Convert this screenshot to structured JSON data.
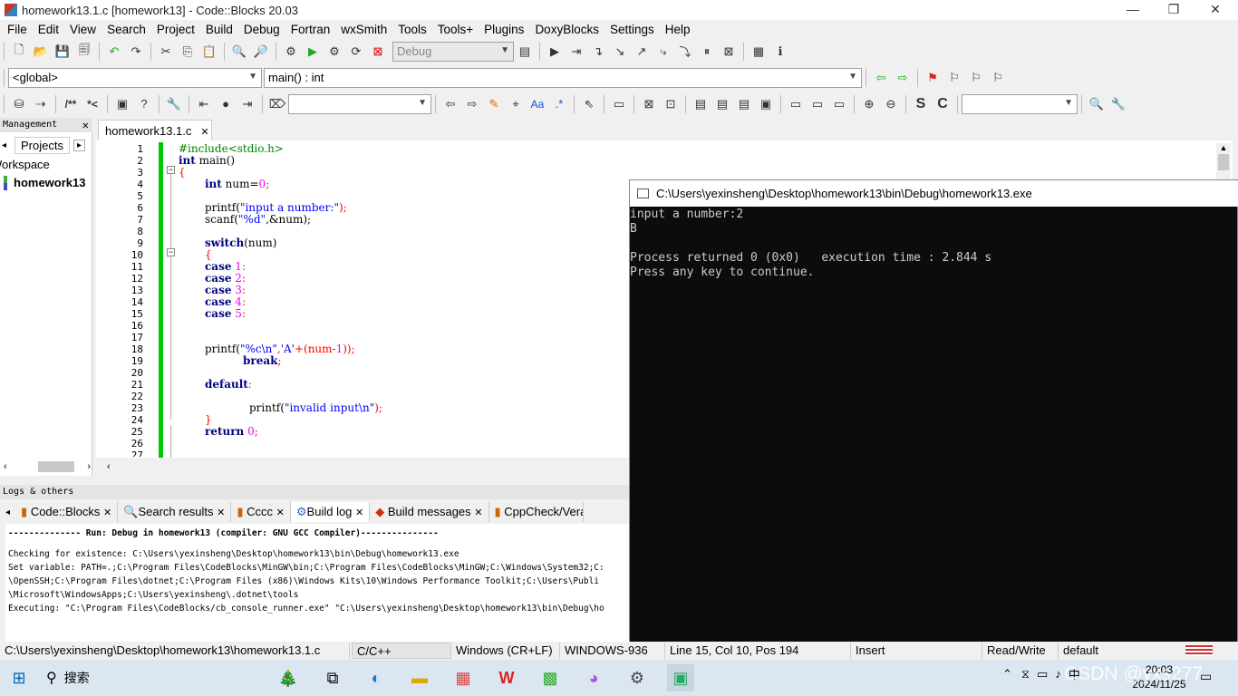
{
  "window": {
    "title": "homework13.1.c [homework13] - Code::Blocks 20.03",
    "min": "—",
    "max": "❐",
    "close": "✕"
  },
  "menu": [
    "File",
    "Edit",
    "View",
    "Search",
    "Project",
    "Build",
    "Debug",
    "Fortran",
    "wxSmith",
    "Tools",
    "Tools+",
    "Plugins",
    "DoxyBlocks",
    "Settings",
    "Help"
  ],
  "toolbar": {
    "build_target": "Debug",
    "scope": "<global>",
    "function": "main() : int"
  },
  "management": {
    "header": "Management",
    "tab": "Projects",
    "workspace": "Workspace",
    "project": "homework13"
  },
  "editor": {
    "tab": "homework13.1.c",
    "lines": [
      "1",
      "2",
      "3",
      "4",
      "5",
      "6",
      "7",
      "8",
      "9",
      "10",
      "11",
      "12",
      "13",
      "14",
      "15",
      "16",
      "17",
      "18",
      "19",
      "20",
      "21",
      "22",
      "23",
      "24",
      "25",
      "26",
      "27"
    ],
    "code": {
      "l1": "#include<stdio.h>",
      "l2_kw": "int",
      "l2_rest": " main()",
      "l3": "{",
      "l4_kw": "int",
      "l4_rest": " num=",
      "l4_num": "0",
      "l4_end": ";",
      "l6_a": "printf(",
      "l6_str": "\"input a number:\"",
      "l6_b": ");",
      "l7_a": "scanf(",
      "l7_str": "\"%d\"",
      "l7_b": ",&num);",
      "l9_kw": "switch",
      "l9_rest": "(num)",
      "l10": "{",
      "l11_kw": "case",
      "l11_num": " 1",
      "l11_end": ":",
      "l12_kw": "case",
      "l12_num": " 2",
      "l12_end": ":",
      "l13_kw": "case",
      "l13_num": " 3",
      "l13_end": ":",
      "l14_kw": "case",
      "l14_num": " 4",
      "l14_end": ":",
      "l15_kw": "case",
      "l15_num": " 5",
      "l15_end": ":",
      "l18_a": "printf(",
      "l18_str": "\"%c\\n\"",
      "l18_b": ",",
      "l18_chr": "'A'",
      "l18_c": "+(num-",
      "l18_num": "1",
      "l18_d": "));",
      "l19_kw": "break",
      "l19_end": ";",
      "l21_kw": "default",
      "l21_end": ":",
      "l23_a": "printf(",
      "l23_str": "\"invalid input\\n\"",
      "l23_b": ");",
      "l24": "}",
      "l25_kw": "return",
      "l25_num": " 0",
      "l25_end": ";"
    }
  },
  "console": {
    "title": "C:\\Users\\yexinsheng\\Desktop\\homework13\\bin\\Debug\\homework13.exe",
    "lines": [
      "input a number:2",
      "B",
      "",
      "Process returned 0 (0x0)   execution time : 2.844 s",
      "Press any key to continue."
    ]
  },
  "logs": {
    "header": "Logs & others",
    "tabs": [
      "Code::Blocks",
      "Search results",
      "Cccc",
      "Build log",
      "Build messages",
      "CppCheck/Vera"
    ],
    "lines": [
      "-------------- Run: Debug in homework13 (compiler: GNU GCC Compiler)---------------",
      "",
      "Checking for existence: C:\\Users\\yexinsheng\\Desktop\\homework13\\bin\\Debug\\homework13.exe",
      "Set variable: PATH=.;C:\\Program Files\\CodeBlocks\\MinGW\\bin;C:\\Program Files\\CodeBlocks\\MinGW;C:\\Windows\\System32;C:",
      "\\OpenSSH;C:\\Program Files\\dotnet;C:\\Program Files (x86)\\Windows Kits\\10\\Windows Performance Toolkit;C:\\Users\\Publi",
      "\\Microsoft\\WindowsApps;C:\\Users\\yexinsheng\\.dotnet\\tools",
      "Executing: \"C:\\Program Files\\CodeBlocks/cb_console_runner.exe\" \"C:\\Users\\yexinsheng\\Desktop\\homework13\\bin\\Debug\\ho"
    ]
  },
  "status": {
    "path": "C:\\Users\\yexinsheng\\Desktop\\homework13\\homework13.1.c",
    "lang": "C/C++",
    "eol": "Windows (CR+LF)",
    "enc": "WINDOWS-936",
    "pos": "Line 15, Col 10, Pos 194",
    "mode": "Insert",
    "rw": "Read/Write",
    "theme": "default"
  },
  "taskbar": {
    "search": "搜索",
    "time": "20:03",
    "date": "2024/11/25",
    "ime": "中",
    "watermark": "CSDN @yxs277"
  }
}
